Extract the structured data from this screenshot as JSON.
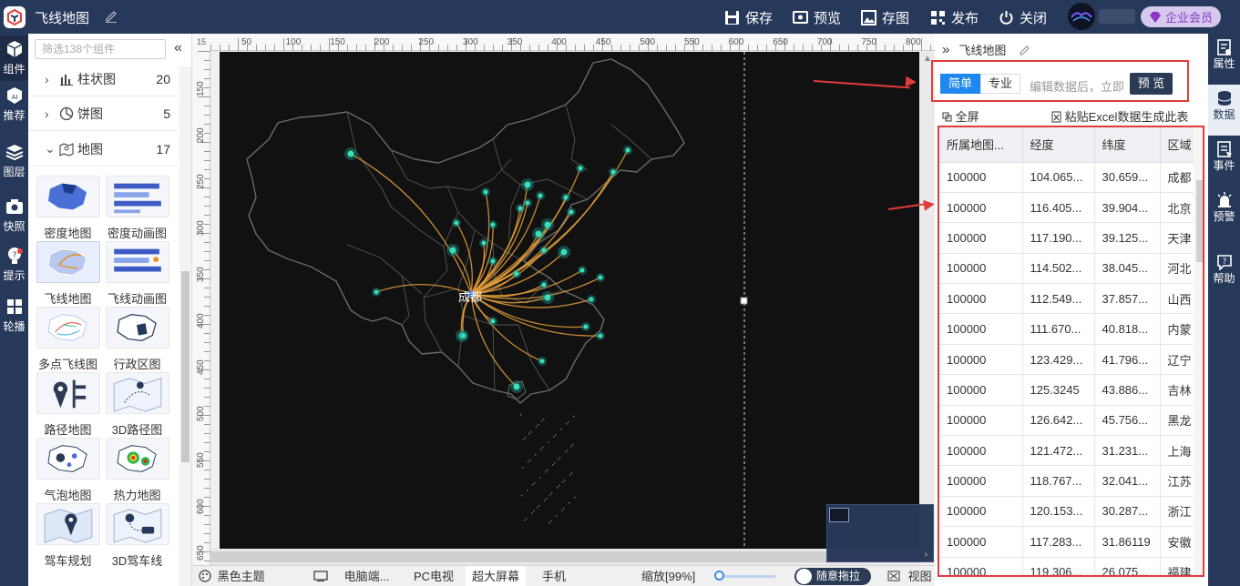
{
  "app": {
    "title": "飞线地图"
  },
  "toolbar": {
    "save": "保存",
    "preview": "预览",
    "save_image": "存图",
    "publish": "发布",
    "close": "关闭",
    "vip": "企业会员"
  },
  "rail_left": [
    {
      "label": "组件",
      "icon": "cube-icon"
    },
    {
      "label": "推荐",
      "icon": "ai-icon"
    },
    {
      "label": "图层",
      "icon": "layers-icon"
    },
    {
      "label": "快照",
      "icon": "camera-icon"
    },
    {
      "label": "提示",
      "icon": "bulb-icon"
    },
    {
      "label": "轮播",
      "icon": "windows-icon"
    }
  ],
  "components": {
    "search_placeholder": "筛选138个组件",
    "categories": [
      {
        "label": "柱状图",
        "count": "20",
        "icon": "bar-chart-icon"
      },
      {
        "label": "饼图",
        "count": "5",
        "icon": "pie-chart-icon"
      },
      {
        "label": "地图",
        "count": "17",
        "icon": "map-pin-icon"
      }
    ],
    "tiles": [
      {
        "label": "密度地图"
      },
      {
        "label": "密度动画图"
      },
      {
        "label": "飞线地图"
      },
      {
        "label": "飞线动画图"
      },
      {
        "label": "多点飞线图"
      },
      {
        "label": "行政区图"
      },
      {
        "label": "路径地图"
      },
      {
        "label": "3D路径图"
      },
      {
        "label": "气泡地图"
      },
      {
        "label": "热力地图"
      },
      {
        "label": "驾车规划"
      },
      {
        "label": "3D驾车线"
      }
    ]
  },
  "ruler": {
    "corner": "15",
    "top_ticks": [
      "50",
      "100",
      "150",
      "200",
      "250",
      "300",
      "350",
      "400",
      "450",
      "500",
      "550",
      "600",
      "650",
      "700",
      "750",
      "800"
    ],
    "left_ticks": [
      "150",
      "200",
      "250",
      "300",
      "350",
      "400",
      "450",
      "500",
      "550",
      "600",
      "650"
    ]
  },
  "map": {
    "center_label": "成都"
  },
  "bottom": {
    "theme": "黑色主题",
    "pc_desktop": "电脑端...",
    "pc_tv": "PC电视",
    "big_screen": "超大屏幕",
    "mobile": "手机",
    "zoom": "缩放[99%]",
    "free_drag": "随意拖拉",
    "view": "视图"
  },
  "right_panel": {
    "title": "飞线地图",
    "mode_simple": "简单",
    "mode_pro": "专业",
    "mode_hint": "编辑数据后，立即",
    "mode_preview": "预 览",
    "fullscreen": "全屏",
    "paste_excel": "粘贴Excel数据生成此表",
    "columns": [
      "所属地图...",
      "经度",
      "纬度",
      "区域"
    ],
    "rows": [
      [
        "100000",
        "104.065...",
        "30.659...",
        "成都"
      ],
      [
        "100000",
        "116.405...",
        "39.904...",
        "北京"
      ],
      [
        "100000",
        "117.190...",
        "39.125...",
        "天津"
      ],
      [
        "100000",
        "114.502...",
        "38.045...",
        "河北"
      ],
      [
        "100000",
        "112.549...",
        "37.857...",
        "山西"
      ],
      [
        "100000",
        "111.670...",
        "40.818...",
        "内蒙"
      ],
      [
        "100000",
        "123.429...",
        "41.796...",
        "辽宁"
      ],
      [
        "100000",
        "125.3245",
        "43.886...",
        "吉林"
      ],
      [
        "100000",
        "126.642...",
        "45.756...",
        "黑龙"
      ],
      [
        "100000",
        "121.472...",
        "31.231...",
        "上海"
      ],
      [
        "100000",
        "118.767...",
        "32.041...",
        "江苏"
      ],
      [
        "100000",
        "120.153...",
        "30.287...",
        "浙江"
      ],
      [
        "100000",
        "117.283...",
        "31.86119",
        "安徽"
      ],
      [
        "100000",
        "119.306...",
        "26.075...",
        "福建"
      ]
    ]
  },
  "rail_right": [
    {
      "label": "属性",
      "icon": "properties-icon"
    },
    {
      "label": "数据",
      "icon": "database-icon"
    },
    {
      "label": "事件",
      "icon": "event-icon"
    },
    {
      "label": "预警",
      "icon": "alarm-icon"
    },
    {
      "label": "帮助",
      "icon": "help-icon"
    }
  ],
  "colors": {
    "topbar": "#27395a",
    "accent": "#1e87f0",
    "highlight": "#e23b3b",
    "flyline": "#f0a030",
    "node": "#2fd6b4"
  }
}
